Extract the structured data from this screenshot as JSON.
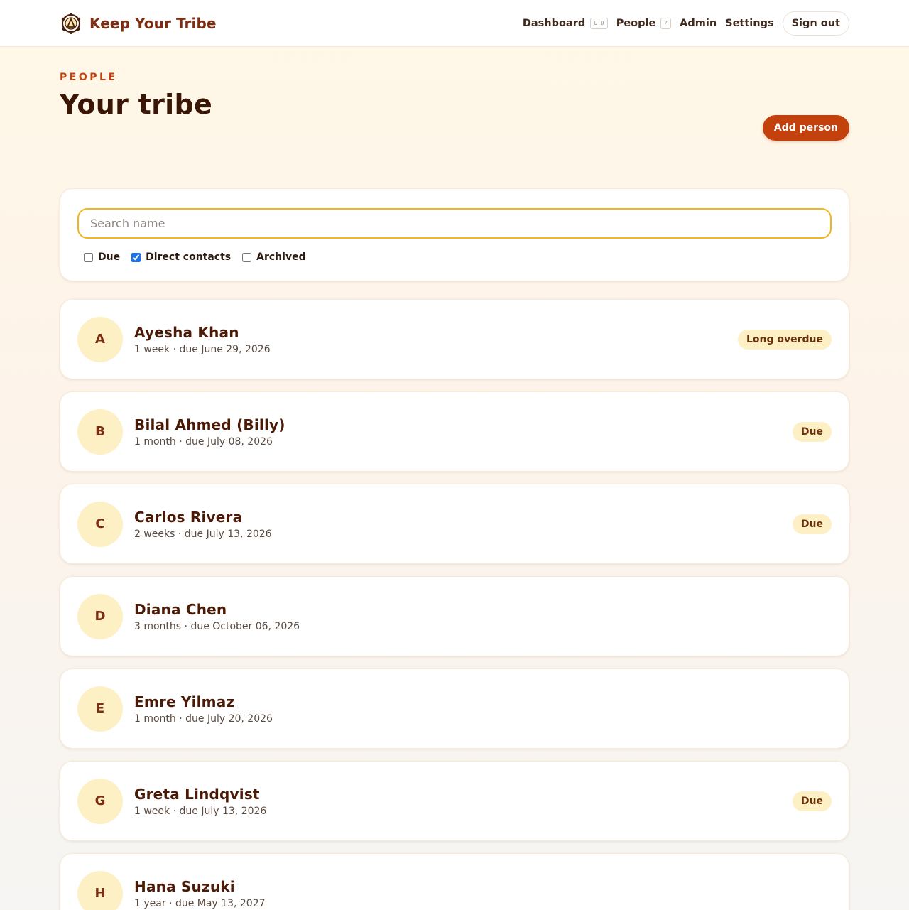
{
  "header": {
    "brand_name": "Keep Your Tribe",
    "nav": {
      "dashboard": "Dashboard",
      "dashboard_shortcut": "G D",
      "people": "People",
      "people_shortcut": "/",
      "admin": "Admin",
      "settings": "Settings",
      "sign_out": "Sign out"
    }
  },
  "page": {
    "eyebrow": "PEOPLE",
    "title": "Your tribe",
    "add_button": "Add person"
  },
  "filters": {
    "search_placeholder": "Search name",
    "search_value": "",
    "options": [
      {
        "label": "Due",
        "checked": false
      },
      {
        "label": "Direct contacts",
        "checked": true
      },
      {
        "label": "Archived",
        "checked": false
      }
    ]
  },
  "people": [
    {
      "initial": "A",
      "name": "Ayesha Khan",
      "meta": "1 week · due June 29, 2026",
      "badge": "Long overdue"
    },
    {
      "initial": "B",
      "name": "Bilal Ahmed (Billy)",
      "meta": "1 month · due July 08, 2026",
      "badge": "Due"
    },
    {
      "initial": "C",
      "name": "Carlos Rivera",
      "meta": "2 weeks · due July 13, 2026",
      "badge": "Due"
    },
    {
      "initial": "D",
      "name": "Diana Chen",
      "meta": "3 months · due October 06, 2026",
      "badge": ""
    },
    {
      "initial": "E",
      "name": "Emre Yilmaz",
      "meta": "1 month · due July 20, 2026",
      "badge": ""
    },
    {
      "initial": "G",
      "name": "Greta Lindqvist",
      "meta": "1 week · due July 13, 2026",
      "badge": "Due"
    },
    {
      "initial": "H",
      "name": "Hana Suzuki",
      "meta": "1 year · due May 13, 2027",
      "badge": ""
    }
  ],
  "colors": {
    "accent": "#c2410c",
    "brand_text": "#7c2d12",
    "badge_bg": "#fdf0c4",
    "search_focus": "#f2b51c"
  }
}
